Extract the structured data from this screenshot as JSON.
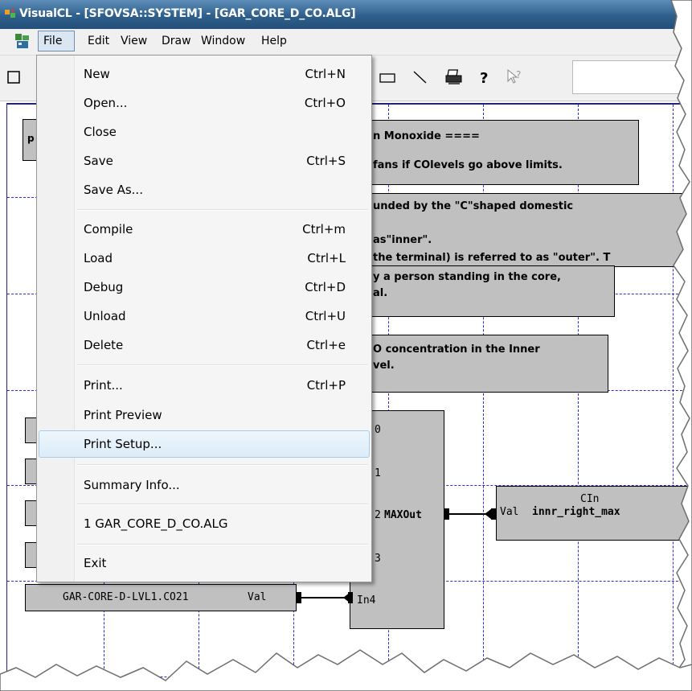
{
  "window": {
    "title": "VisualCL - [SFOVSA::SYSTEM] - [GAR_CORE_D_CO.ALG]"
  },
  "menubar": {
    "items": [
      "File",
      "Edit",
      "View",
      "Draw",
      "Window",
      "Help"
    ]
  },
  "file_menu": {
    "groups": [
      [
        {
          "label": "New",
          "shortcut": "Ctrl+N"
        },
        {
          "label": "Open...",
          "shortcut": "Ctrl+O"
        },
        {
          "label": "Close",
          "shortcut": ""
        },
        {
          "label": "Save",
          "shortcut": "Ctrl+S"
        },
        {
          "label": "Save As...",
          "shortcut": ""
        }
      ],
      [
        {
          "label": "Compile",
          "shortcut": "Ctrl+m"
        },
        {
          "label": "Load",
          "shortcut": "Ctrl+L"
        },
        {
          "label": "Debug",
          "shortcut": "Ctrl+D"
        },
        {
          "label": "Unload",
          "shortcut": "Ctrl+U"
        },
        {
          "label": "Delete",
          "shortcut": "Ctrl+e"
        }
      ],
      [
        {
          "label": "Print...",
          "shortcut": "Ctrl+P"
        },
        {
          "label": "Print Preview",
          "shortcut": ""
        },
        {
          "label": "Print Setup...",
          "shortcut": "",
          "highlighted": true
        }
      ],
      [
        {
          "label": "Summary Info...",
          "shortcut": ""
        }
      ],
      [
        {
          "label": "1 GAR_CORE_D_CO.ALG",
          "shortcut": ""
        }
      ],
      [
        {
          "label": "Exit",
          "shortcut": ""
        }
      ]
    ]
  },
  "toolbar": {
    "icons": [
      "rectangle-tool-icon",
      "line-tool-icon",
      "print-icon",
      "help-icon",
      "context-help-icon"
    ]
  },
  "diagram": {
    "comments": {
      "c1_line1": "n Monoxide ====",
      "c1_line2": "fans if COlevels go above limits.",
      "c2_line1": "unded by the \"C\"shaped domestic",
      "c2_line2": "as\"inner\".",
      "c2_line3": "the terminal) is referred to as \"outer\". T",
      "c3_line1": "y a person standing in the core,",
      "c3_line2": "al.",
      "c4_line1": "O concentration in the Inner",
      "c4_line2": "vel.",
      "left_stub": "p"
    },
    "max_block": {
      "ports": [
        "0",
        "1",
        "2",
        "3",
        "In4"
      ],
      "output": "MAXOut",
      "in2_label": "2"
    },
    "cin_block": {
      "title": "CIn",
      "port": "Val",
      "name": "innr_right_max"
    },
    "source_block": {
      "name": "GAR-CORE-D-LVL1.CO21",
      "port": "Val"
    }
  },
  "colors": {
    "title_bar": "#2f5f8c",
    "block_fill": "#c0c0c0",
    "grid": "#2a2ad8",
    "menu_highlight": "#dcecf8"
  }
}
